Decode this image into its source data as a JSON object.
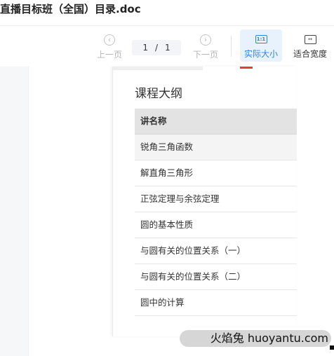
{
  "document": {
    "title": "直播目标班（全国）目录.doc"
  },
  "toolbar": {
    "prev_label": "上一页",
    "next_label": "下一页",
    "prev_icon": "‹",
    "next_icon": "›",
    "page_current": "1",
    "page_sep": "/",
    "page_total": "1",
    "actual_size_label": "实际大小",
    "actual_size_icon_text": "1:1",
    "fit_width_label": "适合宽度",
    "fit_width_icon_text": "↔"
  },
  "page": {
    "section_title": "课程大纲",
    "table": {
      "header": "讲名称",
      "rows": [
        "锐角三角函数",
        "解直角三角形",
        "正弦定理与余弦定理",
        "圆的基本性质",
        "与圆有关的位置关系（一）",
        "与圆有关的位置关系（二）",
        "圆中的计算"
      ]
    }
  },
  "watermark": {
    "text": "火焰兔 huoyantu.com"
  },
  "colors": {
    "accent": "#2f84e0",
    "accent_bg": "#e8f2fd",
    "table_header": "#e3e3e3",
    "mark_red": "#e23c3c"
  }
}
